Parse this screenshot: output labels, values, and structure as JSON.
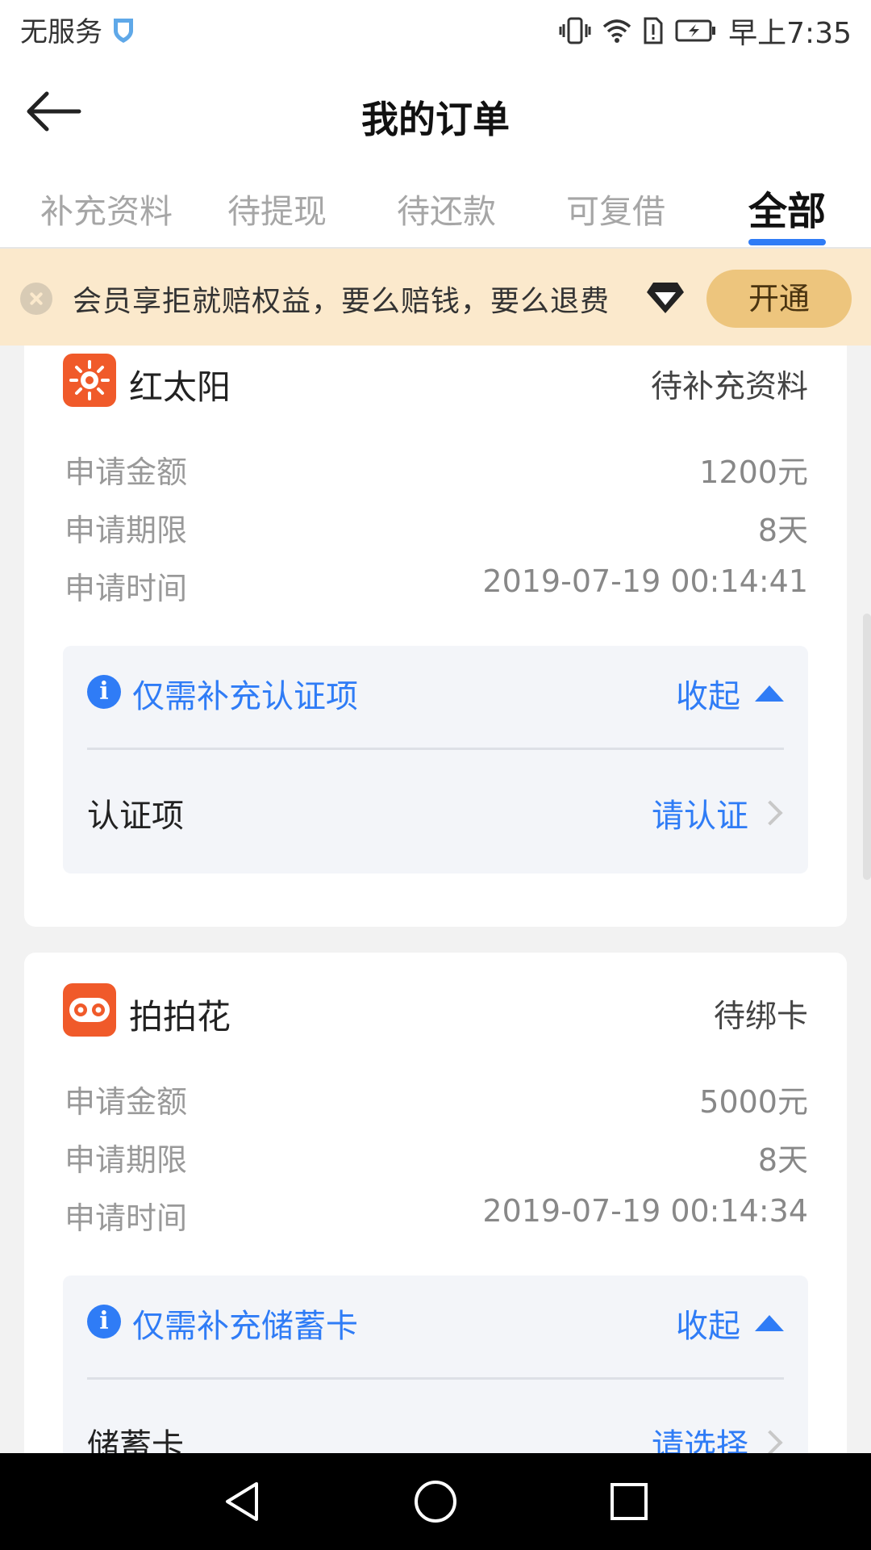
{
  "status_bar": {
    "carrier": "无服务",
    "time": "早上7:35"
  },
  "header": {
    "title": "我的订单"
  },
  "tabs": [
    {
      "label": "补充资料",
      "active": false
    },
    {
      "label": "待提现",
      "active": false
    },
    {
      "label": "待还款",
      "active": false
    },
    {
      "label": "可复借",
      "active": false
    },
    {
      "label": "全部",
      "active": true
    }
  ],
  "banner": {
    "text": "会员享拒就赔权益，要么赔钱，要么退费",
    "button": "开通"
  },
  "orders": [
    {
      "app_name": "红太阳",
      "status": "待补充资料",
      "rows": [
        {
          "label": "申请金额",
          "value": "1200元"
        },
        {
          "label": "申请期限",
          "value": "8天"
        },
        {
          "label": "申请时间",
          "value": "2019-07-19 00:14:41"
        }
      ],
      "info": {
        "title": "仅需补充认证项",
        "collapse": "收起",
        "item_label": "认证项",
        "item_action": "请认证"
      }
    },
    {
      "app_name": "拍拍花",
      "status": "待绑卡",
      "rows": [
        {
          "label": "申请金额",
          "value": "5000元"
        },
        {
          "label": "申请期限",
          "value": "8天"
        },
        {
          "label": "申请时间",
          "value": "2019-07-19 00:14:34"
        }
      ],
      "info": {
        "title": "仅需补充储蓄卡",
        "collapse": "收起",
        "item_label": "储蓄卡",
        "item_action": "请选择"
      }
    }
  ],
  "colors": {
    "accent": "#2f7cf6",
    "banner_bg": "#fbe9cc",
    "button_bg": "#edc57d"
  }
}
